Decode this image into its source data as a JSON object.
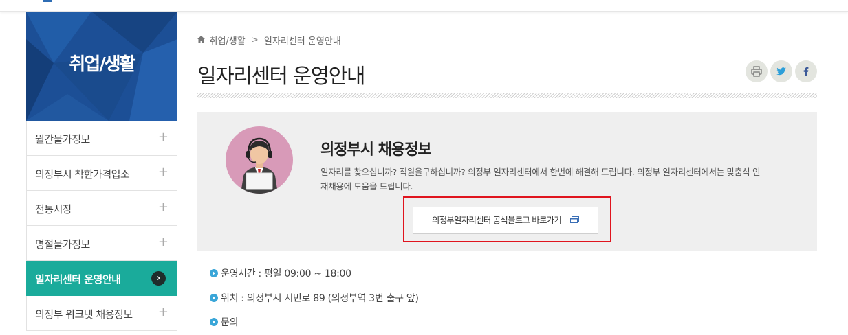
{
  "sidebar": {
    "title": "취업/생활",
    "items": [
      {
        "label": "월간물가정보",
        "active": false
      },
      {
        "label": "의정부시 착한가격업소",
        "active": false
      },
      {
        "label": "전통시장",
        "active": false
      },
      {
        "label": "명절물가정보",
        "active": false
      },
      {
        "label": "일자리센터 운영안내",
        "active": true
      },
      {
        "label": "의정부 워크넷 채용정보",
        "active": false
      }
    ],
    "plus_glyph": "+",
    "arrow_glyph": "›"
  },
  "breadcrumb": {
    "home_icon": "home-icon",
    "items": [
      "취업/생활",
      "일자리센터 운영안내"
    ],
    "separator": ">"
  },
  "page": {
    "title": "일자리센터 운영안내"
  },
  "tools": {
    "print_icon": "print-icon",
    "twitter_icon": "twitter-icon",
    "facebook_icon": "facebook-icon"
  },
  "info": {
    "title": "의정부시 채용정보",
    "description": "일자리를 찾으십니까? 직원을구하십니까? 의정부 일자리센터에서 한번에 해결해 드립니다. 의정부 일자리센터에서는 맞춤식 인재채용에 도움을 드립니다.",
    "button_label": "의정부일자리센터 공식블로그 바로가기",
    "button_icon": "new-window-icon"
  },
  "details": [
    "운영시간 : 평일 09:00 ~ 18:00",
    "위치 : 의정부시 시민로 89 (의정부역 3번 출구 앞)",
    "문의"
  ],
  "colors": {
    "sidebar_header": "#1c4f96",
    "active_item": "#1aab9b",
    "highlight_border": "#e0141e",
    "bullet": "#3aa6d8",
    "avatar_bg": "#d89ab8"
  }
}
